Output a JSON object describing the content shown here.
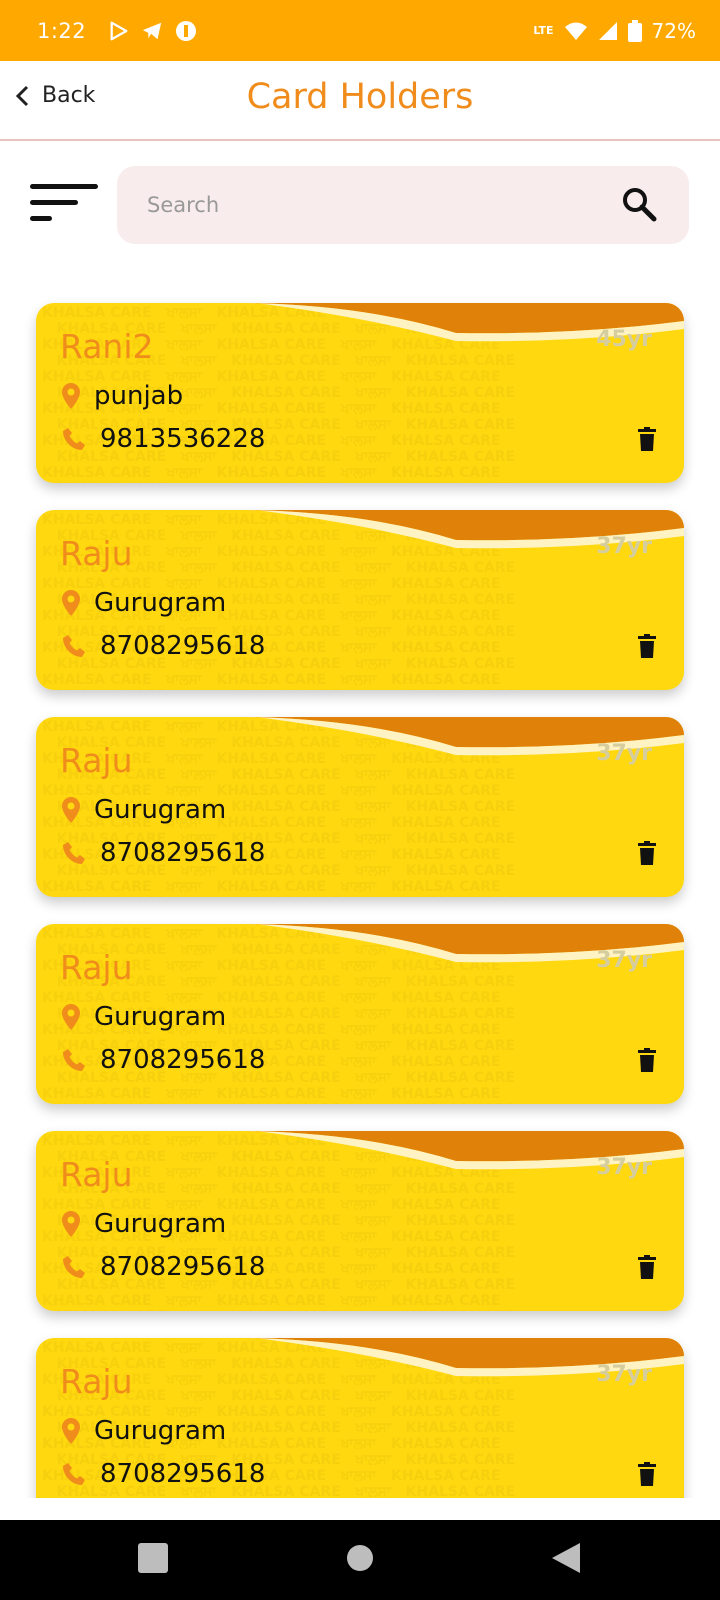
{
  "status": {
    "time": "1:22",
    "battery": "72%",
    "network": "LTE"
  },
  "header": {
    "back_label": "Back",
    "title": "Card Holders"
  },
  "search": {
    "placeholder": "Search",
    "value": ""
  },
  "cards": [
    {
      "name": "Rani2",
      "age": "45yr",
      "location": "punjab",
      "phone": "9813536228"
    },
    {
      "name": "Raju",
      "age": "37yr",
      "location": "Gurugram",
      "phone": "8708295618"
    },
    {
      "name": "Raju",
      "age": "37yr",
      "location": "Gurugram",
      "phone": "8708295618"
    },
    {
      "name": "Raju",
      "age": "37yr",
      "location": "Gurugram",
      "phone": "8708295618"
    },
    {
      "name": "Raju",
      "age": "37yr",
      "location": "Gurugram",
      "phone": "8708295618"
    },
    {
      "name": "Raju",
      "age": "37yr",
      "location": "Gurugram",
      "phone": "8708295618"
    }
  ],
  "icons": {
    "back": "chevron-left-icon",
    "filter": "sort-lines-icon",
    "search": "search-icon",
    "location": "location-pin-icon",
    "phone": "phone-icon",
    "delete": "trash-icon"
  },
  "colors": {
    "status_bar": "#FFA800",
    "title": "#F08C1C",
    "card": "#FFD80F",
    "search_bg": "#F8ECEC"
  }
}
